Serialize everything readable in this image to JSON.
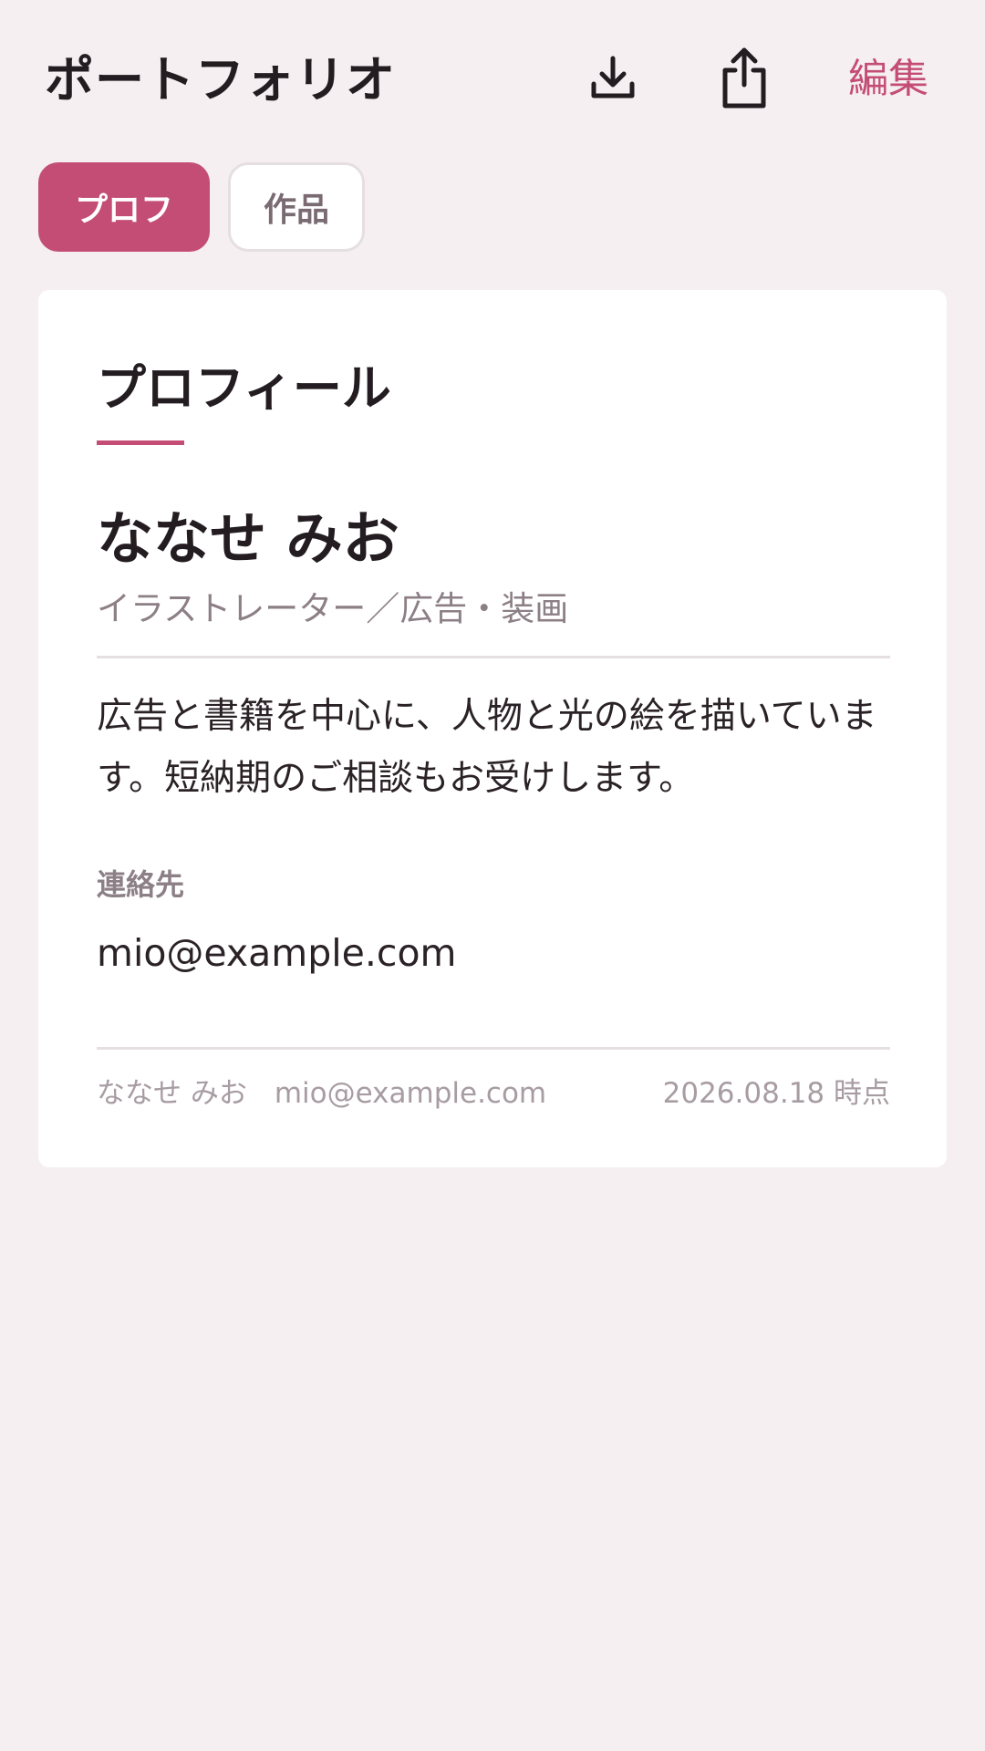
{
  "header": {
    "title": "ポートフォリオ",
    "download_icon": "download-icon",
    "share_icon": "share-icon",
    "edit_label": "編集"
  },
  "tabs": [
    {
      "label": "プロフ",
      "active": true
    },
    {
      "label": "作品",
      "active": false
    }
  ],
  "profile": {
    "section_title": "プロフィール",
    "name": "ななせ みお",
    "role": "イラストレーター／広告・装画",
    "bio": "広告と書籍を中心に、人物と光の絵を描いています。短納期のご相談もお受けします。",
    "contact_label": "連絡先",
    "contact_email": "mio@example.com"
  },
  "footer": {
    "name": "ななせ みお",
    "email": "mio@example.com",
    "timestamp": "2026.08.18 時点"
  },
  "colors": {
    "accent": "#c44d75",
    "background": "#f5eff1",
    "card": "#ffffff",
    "text": "#231c20",
    "muted": "#8c7f86"
  }
}
